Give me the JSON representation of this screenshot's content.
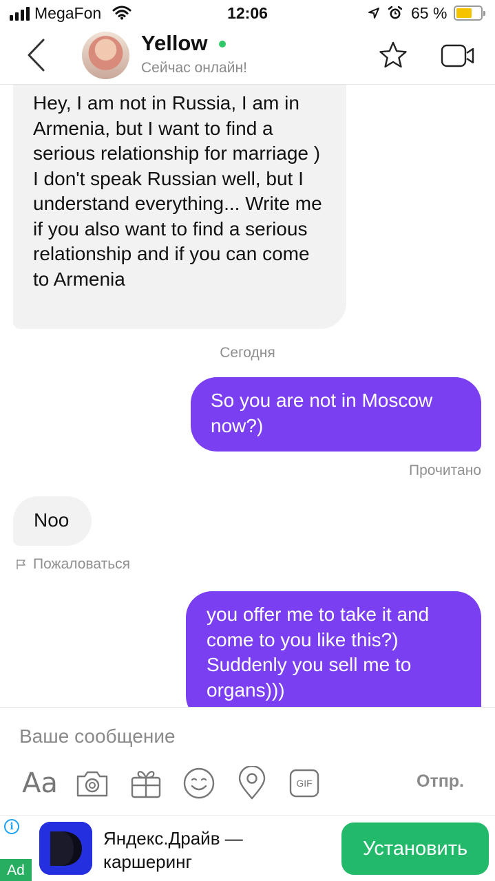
{
  "status_bar": {
    "carrier": "MegaFon",
    "time": "12:06",
    "battery_percent": "65 %",
    "battery_level": 0.65,
    "icons": [
      "signal-icon",
      "wifi-icon",
      "location-arrow-icon",
      "alarm-icon",
      "battery-icon"
    ]
  },
  "header": {
    "contact_name": "Yellow",
    "contact_status": "Сейчас онлайн!",
    "online_color": "#2fc76a",
    "icons": [
      "back-chevron-icon",
      "star-icon",
      "video-camera-icon"
    ]
  },
  "messages": [
    {
      "direction": "incoming",
      "text": "Hey, I am not in Russia, I am in Armenia, but I want to find a serious relationship for marriage ) I don't speak Russian well, but I understand everything... Write me if you also want to find a serious relationship and if you can come to Armenia"
    },
    {
      "direction": "outgoing",
      "text": "So you are not in Moscow now?)"
    },
    {
      "direction": "incoming",
      "text": "Noo"
    },
    {
      "direction": "outgoing",
      "text": "you offer me to take it and come to you like this?) Suddenly you sell me to organs)))"
    }
  ],
  "day_separator": "Сегодня",
  "read_status": "Прочитано",
  "report_label": "Пожаловаться",
  "composer": {
    "placeholder": "Ваше сообщение",
    "text_format_label": "Aa",
    "gif_label": "GIF",
    "send_label": "Отпр.",
    "tools": [
      "text-format-icon",
      "camera-icon",
      "gift-icon",
      "emoji-icon",
      "location-pin-icon",
      "gif-icon"
    ]
  },
  "ad": {
    "info_label": "i",
    "badge": "Ad",
    "title": "Яндекс.Драйв — каршеринг",
    "button_label": "Установить",
    "button_color": "#22b96a"
  },
  "colors": {
    "outgoing_bubble": "#7b3ff2",
    "incoming_bubble": "#f2f2f2",
    "accent_green": "#22b96a"
  }
}
